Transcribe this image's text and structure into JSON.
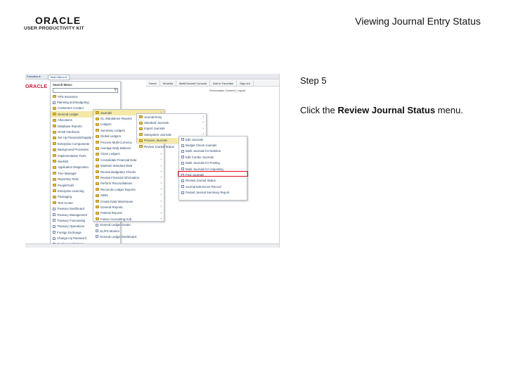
{
  "logo": {
    "brand": "ORACLE",
    "sub": "USER PRODUCTIVITY KIT"
  },
  "slide_title": "Viewing Journal Entry Status",
  "step_label": "Step 5",
  "instruction": {
    "prefix": "Click the ",
    "bold": "Review Journal Status",
    "suffix": " menu."
  },
  "app": {
    "tabs": {
      "favorites": "Favorites ▾",
      "main_menu": "Main Menu ▾"
    },
    "brand": "ORACLE",
    "header_links": [
      "Home",
      "Worklist",
      "MultiChannel Console",
      "Add to Favorites",
      "Sign out"
    ],
    "personalize": "Personalize Content | Layout",
    "search_label": "Search Menu:",
    "menu_root": [
      {
        "label": "VPS Insurance",
        "icon": "folder"
      },
      {
        "label": "Planning and Budgeting",
        "icon": "doc"
      },
      {
        "label": "Customers Contact",
        "icon": "folder"
      },
      {
        "label": "General Ledger",
        "icon": "folder",
        "active": true
      },
      {
        "label": "Allocations",
        "icon": "folder"
      },
      {
        "label": "Database Reports",
        "icon": "folder"
      },
      {
        "label": "OCMI Interfaces",
        "icon": "folder"
      },
      {
        "label": "Set Up Financials/Supply Chain",
        "icon": "folder"
      },
      {
        "label": "Enterprise Components",
        "icon": "folder"
      },
      {
        "label": "Background Processes",
        "icon": "folder"
      },
      {
        "label": "Implementation Tools",
        "icon": "folder"
      },
      {
        "label": "Worklist",
        "icon": "folder"
      },
      {
        "label": "Application Diagnostics",
        "icon": "folder"
      },
      {
        "label": "Tree Manager",
        "icon": "folder"
      },
      {
        "label": "Reporting Tools",
        "icon": "folder"
      },
      {
        "label": "PeopleTools",
        "icon": "folder"
      },
      {
        "label": "Enterprise Learning",
        "icon": "folder"
      },
      {
        "label": "Packaging",
        "icon": "folder"
      },
      {
        "label": "Test Center",
        "icon": "folder"
      },
      {
        "label": "Treasury Dashboard",
        "icon": "doc"
      },
      {
        "label": "Treasury Management",
        "icon": "doc"
      },
      {
        "label": "Treasury Forecasting",
        "icon": "doc"
      },
      {
        "label": "Treasury Operations",
        "icon": "doc"
      },
      {
        "label": "Foreign Exchange",
        "icon": "doc"
      },
      {
        "label": "Change my Password",
        "icon": "doc"
      },
      {
        "label": "My Personalizations",
        "icon": "doc"
      },
      {
        "label": "My System Profile",
        "icon": "doc"
      },
      {
        "label": "My Dictionary",
        "icon": "doc"
      },
      {
        "label": "My Feeds",
        "icon": "doc"
      }
    ],
    "menu_gl": [
      {
        "label": "Journals",
        "icon": "folder",
        "active": true
      },
      {
        "label": "GL Standalone Reports",
        "icon": "folder"
      },
      {
        "label": "Ledgers",
        "icon": "folder"
      },
      {
        "label": "Summary Ledgers",
        "icon": "folder"
      },
      {
        "label": "Global Ledgers",
        "icon": "folder"
      },
      {
        "label": "Process Multi-Currency",
        "icon": "folder"
      },
      {
        "label": "Average Daily Balance",
        "icon": "folder"
      },
      {
        "label": "Close Ledgers",
        "icon": "folder"
      },
      {
        "label": "Consolidate Financial Data",
        "icon": "folder"
      },
      {
        "label": "Maintain Standard Data",
        "icon": "folder"
      },
      {
        "label": "Review Budgetary Checks",
        "icon": "folder"
      },
      {
        "label": "Review Financial Information",
        "icon": "folder"
      },
      {
        "label": "Perform Reconciliations",
        "icon": "folder"
      },
      {
        "label": "Reconcile Ledger Reports",
        "icon": "folder"
      },
      {
        "label": "XBRL",
        "icon": "folder"
      },
      {
        "label": "Create Data Warehouse",
        "icon": "folder"
      },
      {
        "label": "General Reports",
        "icon": "folder"
      },
      {
        "label": "Federal Reports",
        "icon": "folder"
      },
      {
        "label": "Fusion Accounting Hub",
        "icon": "folder"
      },
      {
        "label": "General Ledger Center",
        "icon": "doc"
      },
      {
        "label": "GL/PS Monitor",
        "icon": "doc"
      },
      {
        "label": "General Ledger Dashboard",
        "icon": "doc"
      }
    ],
    "menu_journals": [
      {
        "label": "Journal Entry",
        "icon": "folder"
      },
      {
        "label": "Standard Journals",
        "icon": "folder"
      },
      {
        "label": "Import Journals",
        "icon": "folder"
      },
      {
        "label": "Subsystem Journals",
        "icon": "folder"
      },
      {
        "label": "Process Journals",
        "icon": "folder",
        "active": true
      },
      {
        "label": "Review Journal Status",
        "icon": "folder"
      }
    ],
    "menu_process": [
      {
        "label": "Edit Journals"
      },
      {
        "label": "Budget Check Journals"
      },
      {
        "label": "Mark Journals for Deletion"
      },
      {
        "label": "Edit Combo Journals"
      },
      {
        "label": "Mark Journals for Posting"
      },
      {
        "label": "Mark Journals for Unposting"
      },
      {
        "label": "Post Journals"
      },
      {
        "label": "Review Journal Status"
      },
      {
        "label": "Journal Edit Errors Record"
      },
      {
        "label": "Posted Journal Summary Report"
      }
    ]
  }
}
